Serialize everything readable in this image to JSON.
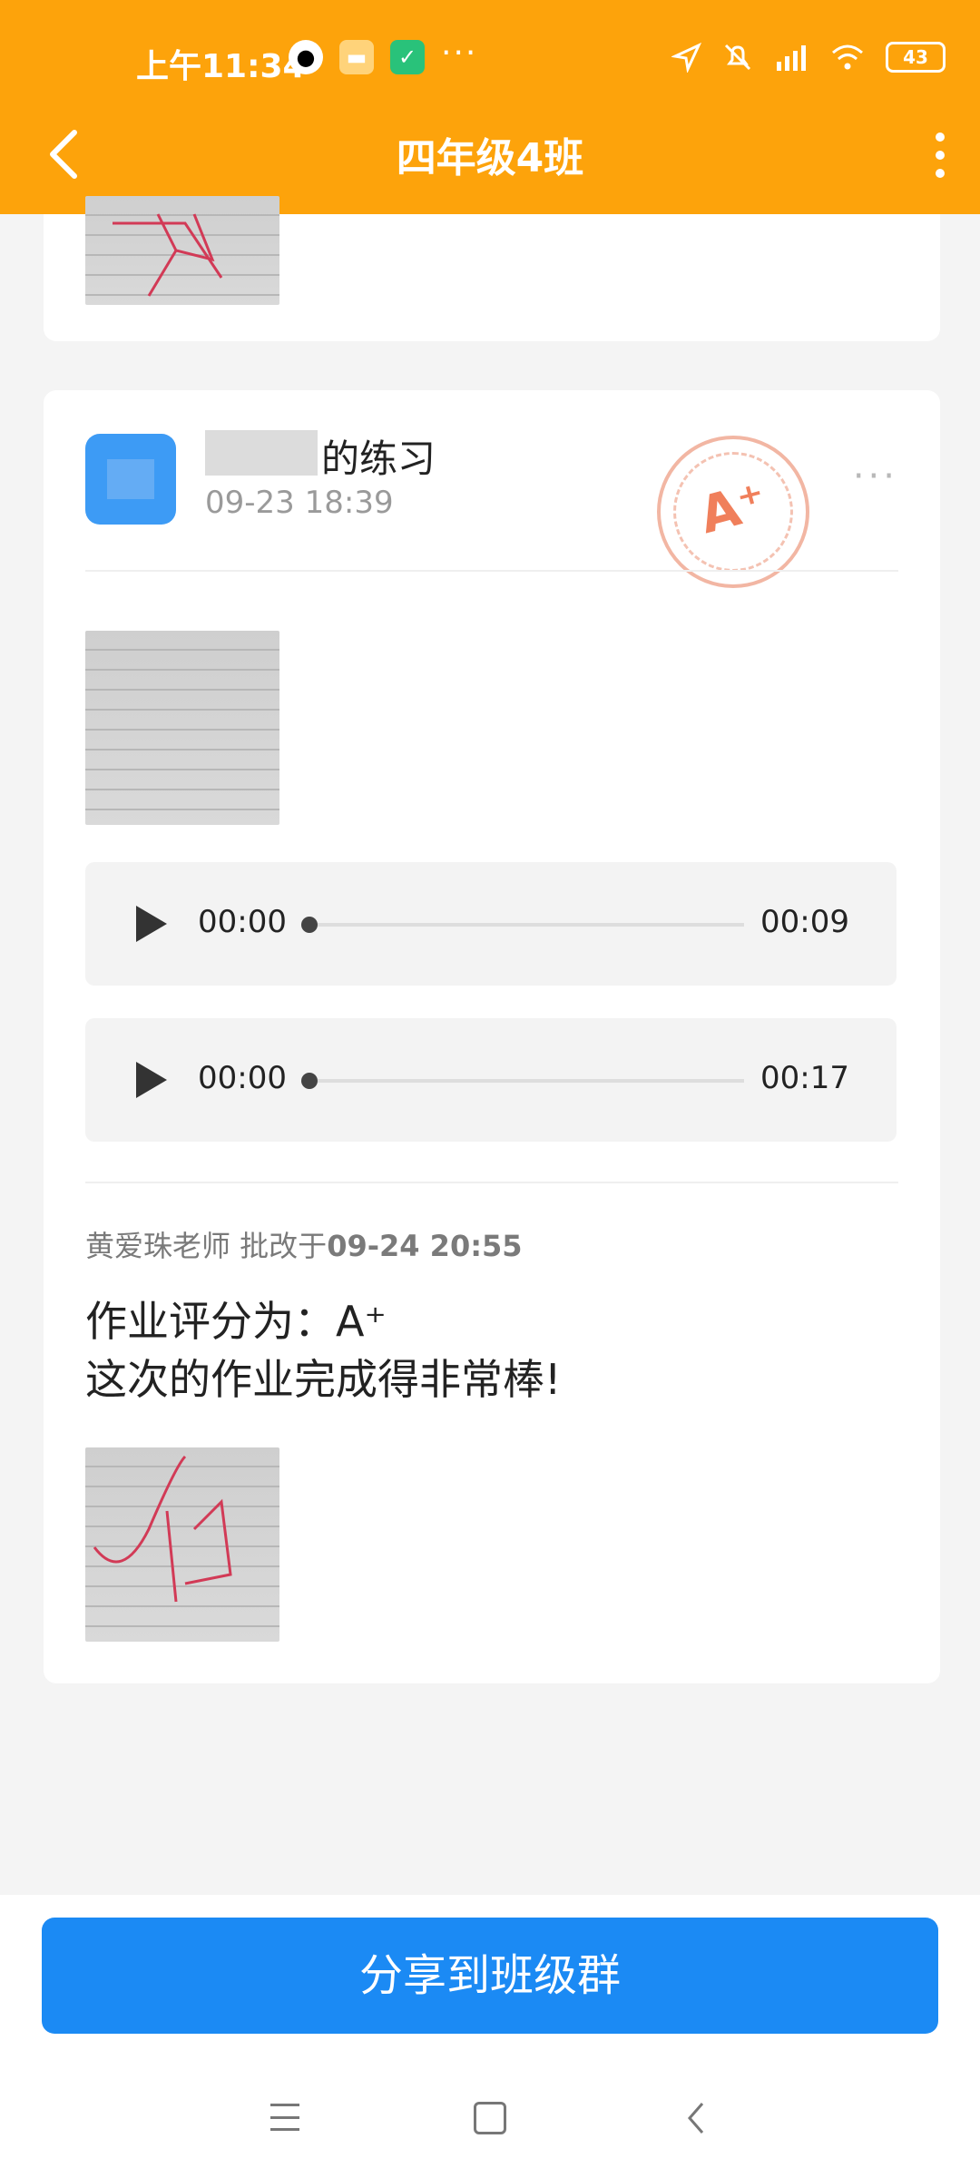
{
  "status_bar": {
    "time": "上午11:34",
    "battery": "43"
  },
  "nav": {
    "title": "四年级4班"
  },
  "post": {
    "title_suffix": "的练习",
    "date": "09-23 18:39",
    "stamp_grade": "A⁺",
    "more": "···",
    "audio": [
      {
        "start": "00:00",
        "end": "00:09"
      },
      {
        "start": "00:00",
        "end": "00:17"
      }
    ],
    "grader": {
      "name_prefix": "黄爱珠老师 批改于",
      "datetime": "09-24 20:55"
    },
    "grade_line": "作业评分为：A⁺",
    "comment": "这次的作业完成得非常棒!"
  },
  "share": {
    "label": "分享到班级群"
  },
  "colors": {
    "header": "#fda30b",
    "share_button": "#1b8af4",
    "avatar": "#3d9bf5"
  }
}
